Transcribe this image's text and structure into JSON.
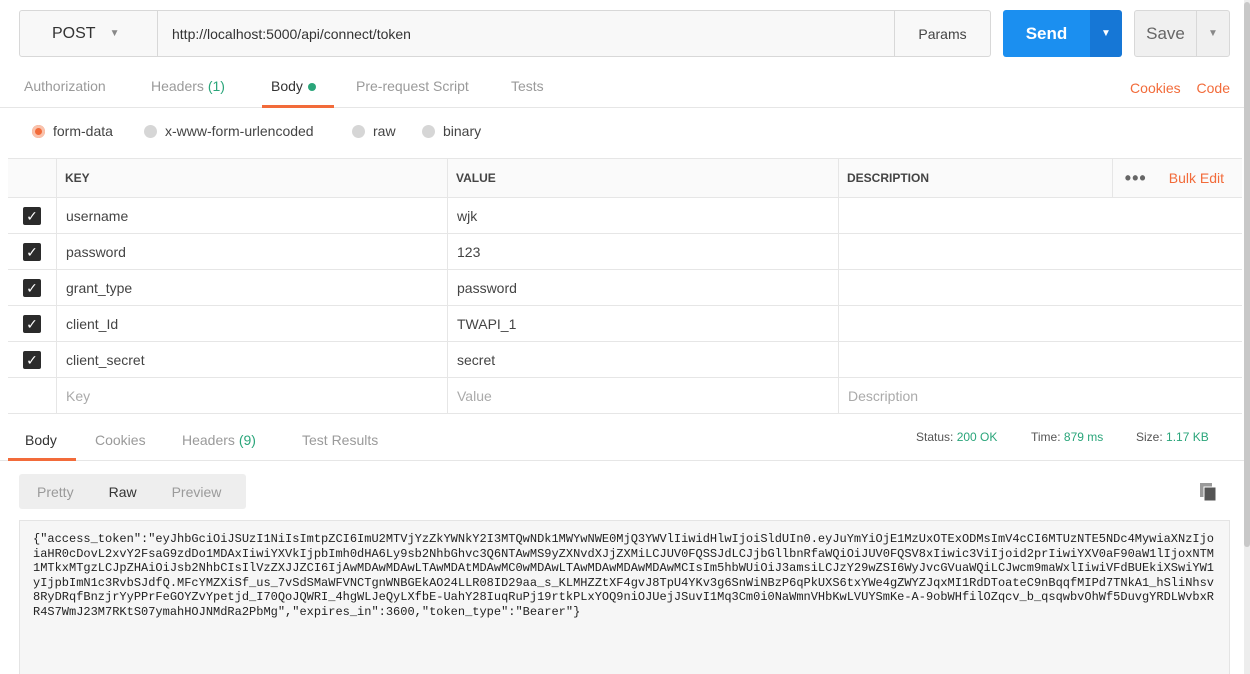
{
  "request": {
    "method": "POST",
    "url": "http://localhost:5000/api/connect/token",
    "params_label": "Params",
    "send_label": "Send",
    "save_label": "Save"
  },
  "request_tabs": {
    "authorization": "Authorization",
    "headers": "Headers",
    "headers_count": "(1)",
    "body": "Body",
    "prerequest": "Pre-request Script",
    "tests": "Tests",
    "cookies": "Cookies",
    "code": "Code"
  },
  "body_types": [
    "form-data",
    "x-www-form-urlencoded",
    "raw",
    "binary"
  ],
  "body_type_selected": "form-data",
  "kv_table": {
    "headers": {
      "key": "KEY",
      "value": "VALUE",
      "description": "DESCRIPTION",
      "more": "•••",
      "bulk_edit": "Bulk Edit"
    },
    "rows": [
      {
        "key": "username",
        "value": "wjk",
        "description": ""
      },
      {
        "key": "password",
        "value": "123",
        "description": ""
      },
      {
        "key": "grant_type",
        "value": "password",
        "description": ""
      },
      {
        "key": "client_Id",
        "value": "TWAPI_1",
        "description": ""
      },
      {
        "key": "client_secret",
        "value": "secret",
        "description": ""
      }
    ],
    "placeholders": {
      "key": "Key",
      "value": "Value",
      "description": "Description"
    }
  },
  "response_tabs": {
    "body": "Body",
    "cookies": "Cookies",
    "headers": "Headers",
    "headers_count": "(9)",
    "test_results": "Test Results"
  },
  "status": {
    "status_label": "Status:",
    "status_value": "200 OK",
    "time_label": "Time:",
    "time_value": "879 ms",
    "size_label": "Size:",
    "size_value": "1.17 KB"
  },
  "view_modes": {
    "pretty": "Pretty",
    "raw": "Raw",
    "preview": "Preview"
  },
  "response_body": "{\"access_token\":\"eyJhbGciOiJSUzI1NiIsImtpZCI6ImU2MTVjYzZkYWNkY2I3MTQwNDk1MWYwNWE0MjQ3YWVlIiwidHlwIjoiSldUIn0.eyJuYmYiOjE1MzUxOTExODMsImV4cCI6MTUzNTE5NDc4MywiaXNzIjoiaHR0cDovL2xvY2FsaG9zdDo1MDAxIiwiYXVkIjpbImh0dHA6Ly9sb2NhbGhvc3Q6NTAwMS9yZXNvdXJjZXMiLCJUV0FQSSJdLCJjbGllbnRfaWQiOiJUV0FQSV8xIiwic3ViIjoid2prIiwiYXV0aF90aW1lIjoxNTM1MTkxMTgzLCJpZHAiOiJsb2NhbCIsIlVzZXJJZCI6IjAwMDAwMDAwLTAwMDAtMDAwMC0wMDAwLTAwMDAwMDAwMDAwMCIsIm5hbWUiOiJ3amsiLCJzY29wZSI6WyJvcGVuaWQiLCJwcm9maWxlIiwiVFdBUEkiXSwiYW1yIjpbImN1c3RvbSJdfQ.MFcYMZXiSf_us_7vSdSMaWFVNCTgnWNBGEkAO24LLR08ID29aa_s_KLMHZZtXF4gvJ8TpU4YKv3g6SnWiNBzP6qPkUXS6txYWe4gZWYZJqxMI1RdDToateC9nBqqfMIPd7TNkA1_hSliNhsv8RyDRqfBnzjrYyPPrFeGOYZvYpetjd_I70QoJQWRI_4hgWLJeQyLXfbE-UahY28IuqRuPj19rtkPLxYOQ9niOJUejJSuvI1Mq3Cm0i0NaWmnVHbKwLVUYSmKe-A-9obWHfilOZqcv_b_qsqwbvOhWf5DuvgYRDLWvbxRR4S7WmJ23M7RKtS07ymahHOJNMdRa2PbMg\",\"expires_in\":3600,\"token_type\":\"Bearer\"}"
}
